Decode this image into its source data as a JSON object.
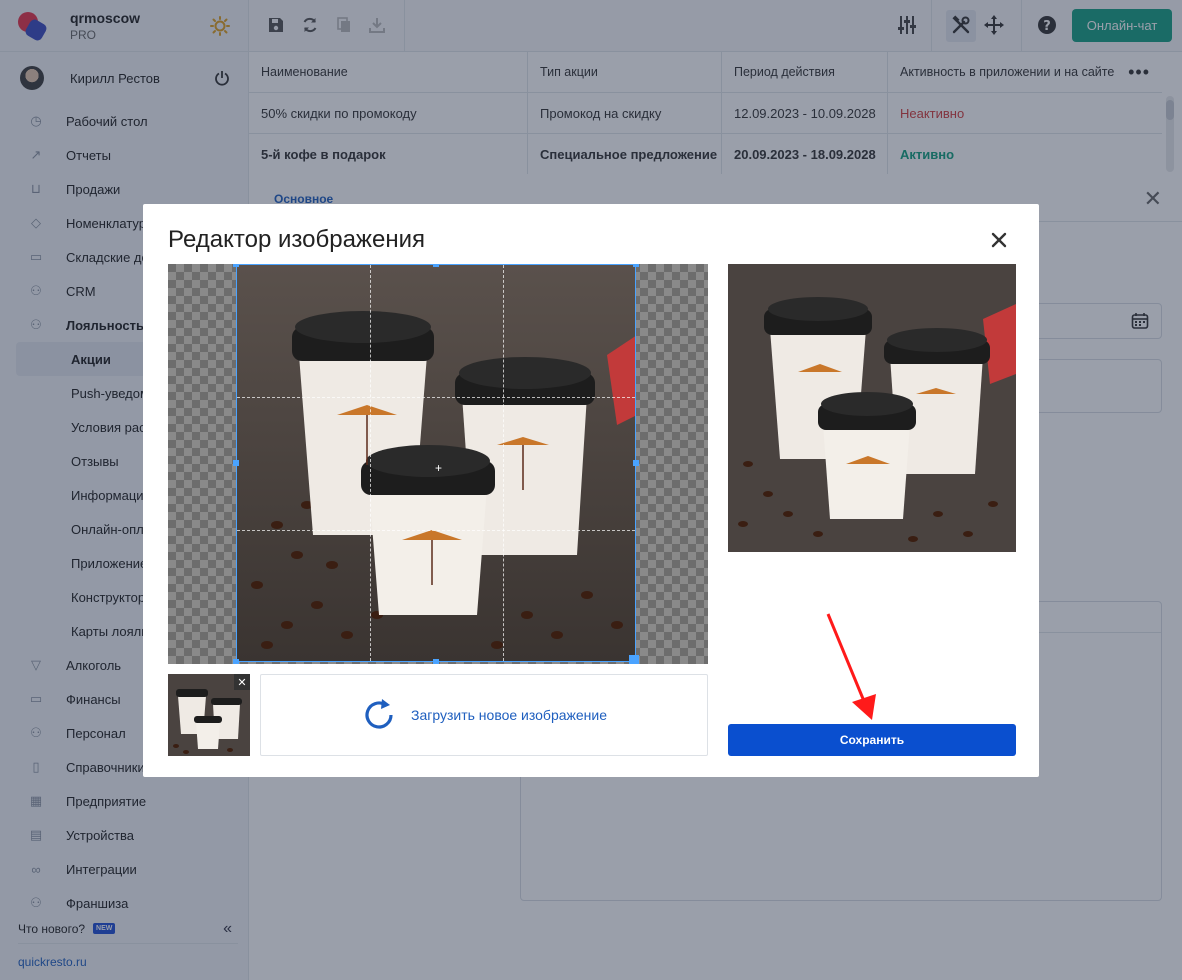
{
  "brand": {
    "name": "qrmoscow",
    "plan": "PRO"
  },
  "user": {
    "name": "Кирилл Рестов"
  },
  "nav": {
    "items": [
      {
        "label": "Рабочий стол",
        "icon": "dashboard-icon",
        "glyph": "◷"
      },
      {
        "label": "Отчеты",
        "icon": "reports-icon",
        "glyph": "↗"
      },
      {
        "label": "Продажи",
        "icon": "basket-icon",
        "glyph": "⊔"
      },
      {
        "label": "Номенклатура",
        "icon": "tag-icon",
        "glyph": "◇"
      },
      {
        "label": "Складские документы",
        "icon": "warehouse-icon",
        "glyph": "▭"
      },
      {
        "label": "CRM",
        "icon": "crm-icon",
        "glyph": "⚇"
      },
      {
        "label": "Лояльность",
        "icon": "loyalty-icon",
        "glyph": "⚇"
      }
    ],
    "sub_items": [
      "Акции",
      "Push-уведомления",
      "Условия расчета",
      "Отзывы",
      "Информация",
      "Онлайн-оплата",
      "Приложение",
      "Конструктор",
      "Карты лояльности"
    ],
    "items2": [
      {
        "label": "Алкоголь",
        "icon": "glass-icon",
        "glyph": "▽"
      },
      {
        "label": "Финансы",
        "icon": "wallet-icon",
        "glyph": "▭"
      },
      {
        "label": "Персонал",
        "icon": "staff-icon",
        "glyph": "⚇"
      },
      {
        "label": "Справочники",
        "icon": "book-icon",
        "glyph": "▯"
      },
      {
        "label": "Предприятие",
        "icon": "store-icon",
        "glyph": "▦"
      },
      {
        "label": "Устройства",
        "icon": "printer-icon",
        "glyph": "▤"
      },
      {
        "label": "Интеграции",
        "icon": "infinity-icon",
        "glyph": "∞"
      },
      {
        "label": "Франшиза",
        "icon": "franchise-icon",
        "glyph": "⚇"
      }
    ],
    "whats_new": "Что нового?",
    "new_badge": "NEW",
    "site": "quickresto.ru"
  },
  "toolbar": {
    "online_chat": "Онлайн-чат"
  },
  "table": {
    "headers": [
      "Наименование",
      "Тип акции",
      "Период действия",
      "Активность в приложении и на сайте"
    ],
    "rows": [
      {
        "name": "50% скидки по промокоду",
        "type": "Промокод на скидку",
        "period": "12.09.2023 - 10.09.2028",
        "status": "Неактивно"
      },
      {
        "name": "5-й кофе в подарок",
        "type": "Специальное предложение",
        "period": "20.09.2023 - 18.09.2028",
        "status": "Активно"
      }
    ]
  },
  "detail": {
    "tab": "Основное"
  },
  "modal": {
    "title": "Редактор изображения",
    "upload_label": "Загрузить новое изображение",
    "save_label": "Сохранить"
  },
  "colors": {
    "primary": "#0a4fcf",
    "chat": "#16a084",
    "inactive": "#d43d3d",
    "active": "#13a07f"
  }
}
